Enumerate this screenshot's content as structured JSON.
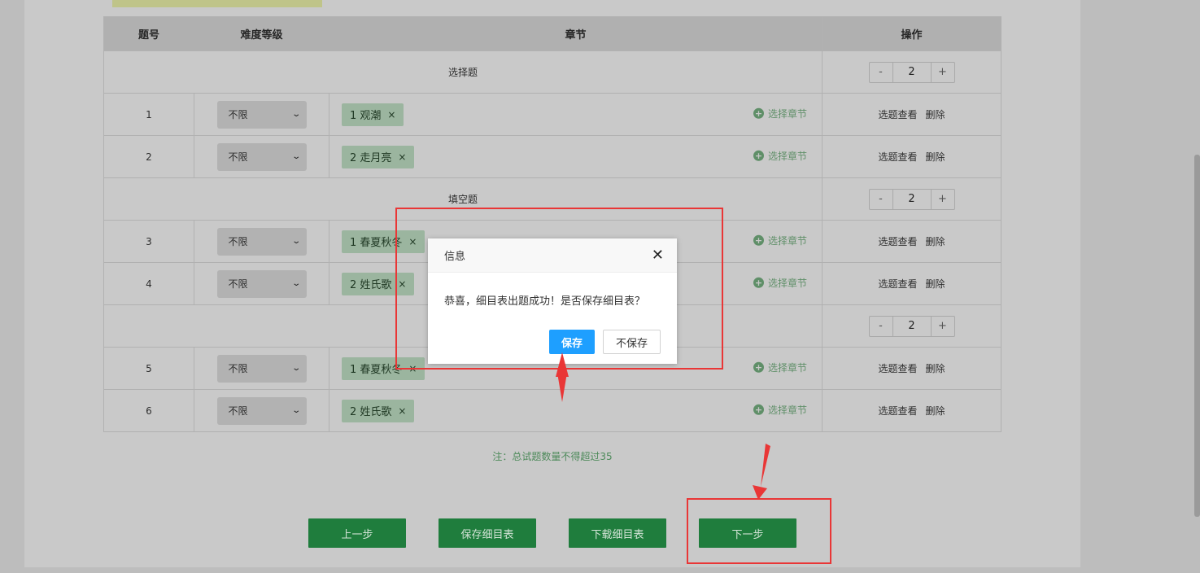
{
  "table": {
    "headers": [
      "题号",
      "难度等级",
      "章节",
      "操作"
    ],
    "sections": [
      {
        "title": "选择题",
        "count": "2",
        "rows": [
          {
            "num": "1",
            "difficulty": "不限",
            "chapter": "1 观潮"
          },
          {
            "num": "2",
            "difficulty": "不限",
            "chapter": "2 走月亮"
          }
        ]
      },
      {
        "title": "填空题",
        "count": "2",
        "rows": [
          {
            "num": "3",
            "difficulty": "不限",
            "chapter": "1 春夏秋冬"
          },
          {
            "num": "4",
            "difficulty": "不限",
            "chapter": "2 姓氏歌"
          }
        ]
      },
      {
        "title": "",
        "count": "2",
        "rows": [
          {
            "num": "5",
            "difficulty": "不限",
            "chapter": "1 春夏秋冬"
          },
          {
            "num": "6",
            "difficulty": "不限",
            "chapter": "2 姓氏歌"
          }
        ]
      }
    ],
    "stepper": {
      "minus": "-",
      "plus": "+"
    },
    "tag_remove": "×",
    "choose_chapter": "选择章节",
    "row_actions": {
      "view": "选题查看",
      "delete": "删除"
    }
  },
  "note": "注：总试题数量不得超过35",
  "buttons": {
    "prev": "上一步",
    "save": "保存细目表",
    "download": "下载细目表",
    "next": "下一步"
  },
  "dialog": {
    "title": "信息",
    "close": "✕",
    "message": "恭喜，细目表出题成功！是否保存细目表？",
    "confirm": "保存",
    "cancel": "不保存"
  },
  "colors": {
    "primary_button": "#1e9fff",
    "action_green": "#1f7d3d",
    "annotation_red": "#e93636"
  }
}
